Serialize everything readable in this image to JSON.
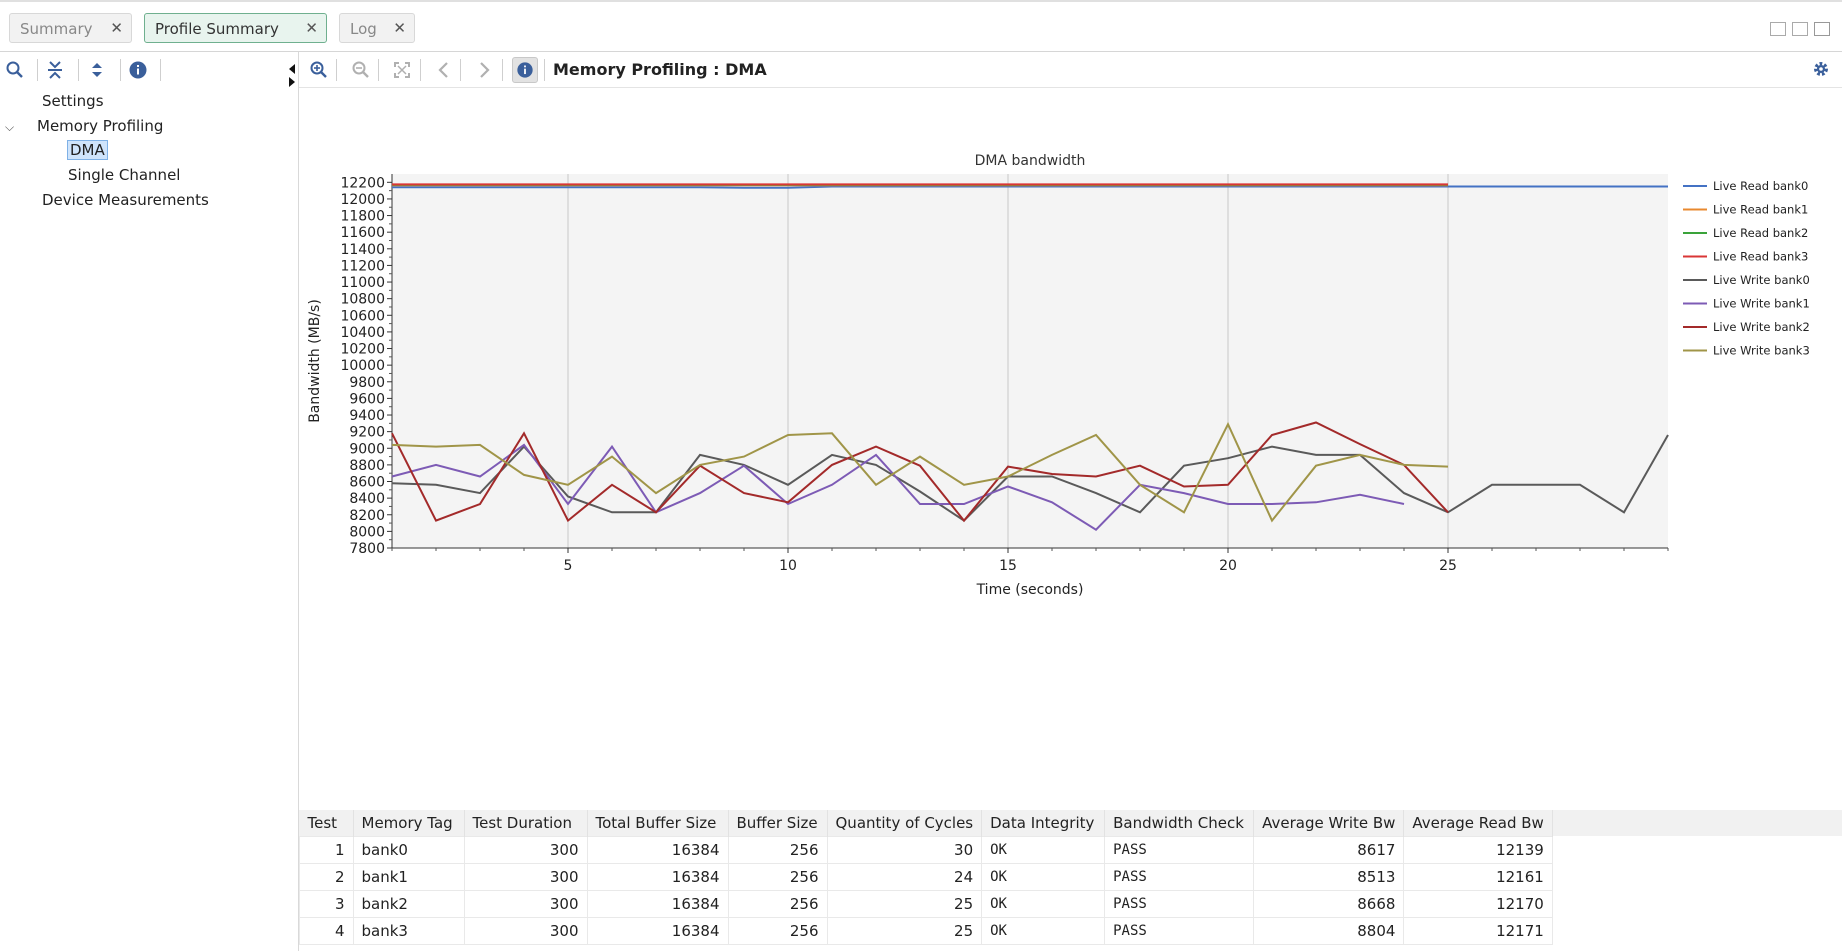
{
  "tabs": [
    {
      "label": "Summary",
      "active": false
    },
    {
      "label": "Profile Summary",
      "active": true
    },
    {
      "label": "Log",
      "active": false
    }
  ],
  "tree": {
    "items": [
      {
        "label": "Settings",
        "level": 0
      },
      {
        "label": "Memory Profiling",
        "level": 0,
        "expanded": true
      },
      {
        "label": "DMA",
        "level": 1,
        "selected": true
      },
      {
        "label": "Single Channel",
        "level": 1
      },
      {
        "label": "Device Measurements",
        "level": 0
      }
    ]
  },
  "page_title": "Memory Profiling : DMA",
  "colors": {
    "accent_green": "#6fb08f",
    "selection": "#cfe4fb",
    "icon_blue": "#3a5f9b"
  },
  "chart_data": {
    "type": "line",
    "title": "DMA bandwidth",
    "xlabel": "Time (seconds)",
    "ylabel": "Bandwidth (MB/s)",
    "xlim": [
      1,
      30
    ],
    "ylim": [
      7800,
      12300
    ],
    "x_ticks": [
      5,
      10,
      15,
      20,
      25
    ],
    "y_ticks": [
      7800,
      8000,
      8200,
      8400,
      8600,
      8800,
      9000,
      9200,
      9400,
      9600,
      9800,
      10000,
      10200,
      10400,
      10600,
      10800,
      11000,
      11200,
      11400,
      11600,
      11800,
      12000,
      12200
    ],
    "grid": true,
    "legend_position": "right",
    "series": [
      {
        "name": "Live Read bank0",
        "color": "#4472c4",
        "x": [
          1,
          2,
          3,
          4,
          5,
          6,
          7,
          8,
          9,
          10,
          11,
          12,
          13,
          14,
          15,
          16,
          17,
          18,
          19,
          20,
          21,
          22,
          23,
          24,
          25,
          26,
          27,
          28,
          29,
          30
        ],
        "values": [
          12140,
          12140,
          12140,
          12140,
          12140,
          12140,
          12140,
          12140,
          12135,
          12135,
          12150,
          12150,
          12150,
          12150,
          12150,
          12150,
          12150,
          12150,
          12150,
          12150,
          12150,
          12150,
          12150,
          12150,
          12150,
          12150,
          12150,
          12150,
          12150,
          12150
        ]
      },
      {
        "name": "Live Read bank1",
        "color": "#e8892f",
        "x": [
          1,
          25
        ],
        "values": [
          12165,
          12165
        ]
      },
      {
        "name": "Live Read bank2",
        "color": "#3aa33a",
        "x": [
          1,
          25
        ],
        "values": [
          12170,
          12170
        ]
      },
      {
        "name": "Live Read bank3",
        "color": "#d93636",
        "x": [
          1,
          25
        ],
        "values": [
          12175,
          12175
        ]
      },
      {
        "name": "Live Write bank0",
        "color": "#5a5a5a",
        "x": [
          1,
          2,
          3,
          4,
          5,
          6,
          7,
          8,
          9,
          10,
          11,
          12,
          13,
          14,
          15,
          16,
          17,
          18,
          19,
          20,
          21,
          22,
          23,
          24,
          25,
          26,
          27,
          28,
          29,
          30
        ],
        "values": [
          8580,
          8560,
          8460,
          9020,
          8420,
          8230,
          8230,
          8920,
          8800,
          8560,
          8920,
          8800,
          8480,
          8130,
          8660,
          8660,
          8460,
          8230,
          8790,
          8880,
          9020,
          8920,
          8920,
          8460,
          8230,
          8560,
          8560,
          8560,
          8230,
          9160
        ]
      },
      {
        "name": "Live Write bank1",
        "color": "#7d5bb5",
        "x": [
          1,
          2,
          3,
          4,
          5,
          6,
          7,
          8,
          9,
          10,
          11,
          12,
          13,
          14,
          15,
          16,
          17,
          18,
          19,
          20,
          21,
          22,
          23,
          24
        ],
        "values": [
          8660,
          8800,
          8660,
          9040,
          8330,
          9020,
          8230,
          8460,
          8790,
          8330,
          8560,
          8920,
          8330,
          8330,
          8540,
          8350,
          8020,
          8560,
          8460,
          8330,
          8330,
          8350,
          8440,
          8330
        ]
      },
      {
        "name": "Live Write bank2",
        "color": "#a32a2a",
        "x": [
          1,
          2,
          3,
          4,
          5,
          6,
          7,
          8,
          9,
          10,
          11,
          12,
          13,
          14,
          15,
          16,
          17,
          18,
          19,
          20,
          21,
          22,
          23,
          24,
          25
        ],
        "values": [
          9180,
          8130,
          8330,
          9180,
          8130,
          8560,
          8230,
          8790,
          8460,
          8350,
          8800,
          9020,
          8790,
          8130,
          8780,
          8690,
          8660,
          8790,
          8540,
          8560,
          9160,
          9310,
          9050,
          8800,
          8230
        ]
      },
      {
        "name": "Live Write bank3",
        "color": "#a09548",
        "x": [
          1,
          2,
          3,
          4,
          5,
          6,
          7,
          8,
          9,
          10,
          11,
          12,
          13,
          14,
          15,
          16,
          17,
          18,
          19,
          20,
          21,
          22,
          23,
          24,
          25
        ],
        "values": [
          9040,
          9020,
          9040,
          8680,
          8560,
          8900,
          8460,
          8800,
          8900,
          9160,
          9180,
          8560,
          8900,
          8560,
          8660,
          8920,
          9160,
          8560,
          8230,
          9290,
          8130,
          8790,
          8920,
          8800,
          8780
        ]
      }
    ]
  },
  "table": {
    "columns": [
      "Test",
      "Memory Tag",
      "Test Duration",
      "Total Buffer Size",
      "Buffer Size",
      "Quantity of Cycles",
      "Data Integrity",
      "Bandwidth Check",
      "Average Write Bw",
      "Average Read Bw"
    ],
    "rows": [
      [
        "1",
        "bank0",
        "300",
        "16384",
        "256",
        "30",
        "OK",
        "PASS",
        "8617",
        "12139"
      ],
      [
        "2",
        "bank1",
        "300",
        "16384",
        "256",
        "24",
        "OK",
        "PASS",
        "8513",
        "12161"
      ],
      [
        "3",
        "bank2",
        "300",
        "16384",
        "256",
        "25",
        "OK",
        "PASS",
        "8668",
        "12170"
      ],
      [
        "4",
        "bank3",
        "300",
        "16384",
        "256",
        "25",
        "OK",
        "PASS",
        "8804",
        "12171"
      ]
    ]
  }
}
